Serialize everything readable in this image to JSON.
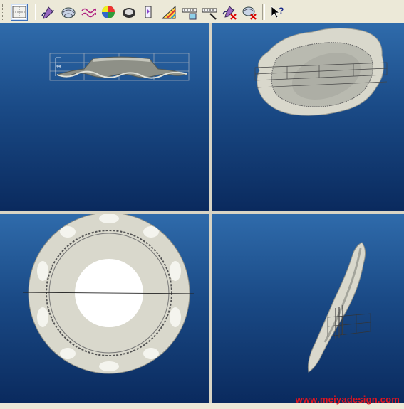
{
  "toolbar": {
    "buttons": [
      {
        "name": "view-layout-icon",
        "active": true
      },
      {
        "name": "curve-pen-icon",
        "active": false
      },
      {
        "name": "surface-shade-icon",
        "active": false
      },
      {
        "name": "wave-curve-icon",
        "active": false
      },
      {
        "name": "color-map-icon",
        "active": false
      },
      {
        "name": "render-disc-icon",
        "active": false
      },
      {
        "name": "draft-analysis-icon",
        "active": false
      },
      {
        "name": "zebra-triangle-icon",
        "active": false
      },
      {
        "name": "ruler-measure-icon",
        "active": false
      },
      {
        "name": "ruler-cut-icon",
        "active": false
      },
      {
        "name": "curve-delete-icon",
        "active": false
      },
      {
        "name": "surface-delete-icon",
        "active": false
      },
      {
        "name": "context-help-icon",
        "active": false
      }
    ]
  },
  "viewports": {
    "front": {
      "name": "front-view"
    },
    "perspective": {
      "name": "perspective-view"
    },
    "top": {
      "name": "top-view"
    },
    "right": {
      "name": "right-view"
    }
  },
  "colors": {
    "viewport_top": "#2f6bab",
    "viewport_bottom": "#0a2a5e",
    "model_surface": "#d9d8cc",
    "watermark": "#e0151f"
  },
  "front_view": {
    "dim_label": "H"
  },
  "watermark_text": "www.meiyadesign.com"
}
